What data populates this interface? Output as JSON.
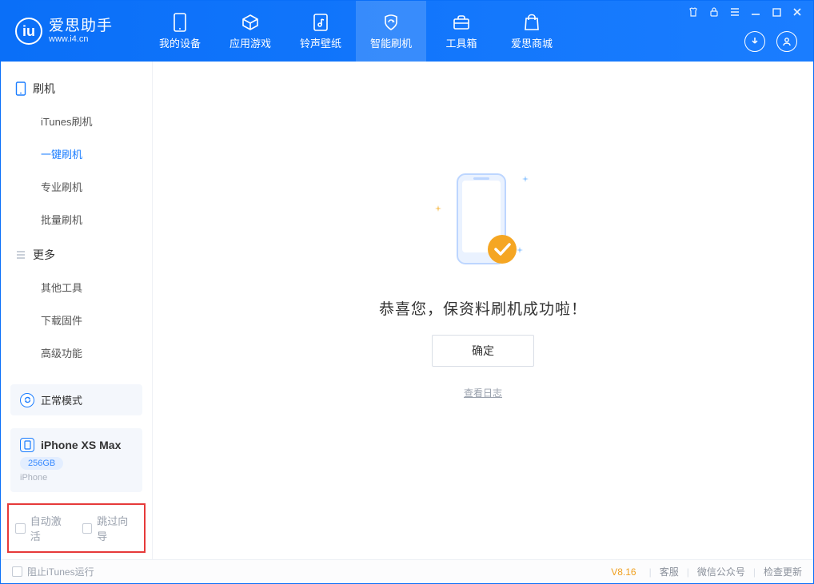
{
  "brand": {
    "title": "爱思助手",
    "subtitle": "www.i4.cn"
  },
  "nav": {
    "items": [
      {
        "label": "我的设备"
      },
      {
        "label": "应用游戏"
      },
      {
        "label": "铃声壁纸"
      },
      {
        "label": "智能刷机"
      },
      {
        "label": "工具箱"
      },
      {
        "label": "爱思商城"
      }
    ],
    "active_index": 3
  },
  "sidebar": {
    "group1_title": "刷机",
    "group1_items": [
      "iTunes刷机",
      "一键刷机",
      "专业刷机",
      "批量刷机"
    ],
    "group1_active_index": 1,
    "group2_title": "更多",
    "group2_items": [
      "其他工具",
      "下载固件",
      "高级功能"
    ],
    "mode_label": "正常模式",
    "device_name": "iPhone XS Max",
    "device_capacity": "256GB",
    "device_type": "iPhone",
    "checkbox_auto_activate": "自动激活",
    "checkbox_skip_guide": "跳过向导"
  },
  "main": {
    "success_title": "恭喜您，保资料刷机成功啦！",
    "ok_button": "确定",
    "view_log": "查看日志"
  },
  "footer": {
    "stop_itunes": "阻止iTunes运行",
    "version": "V8.16",
    "link_support": "客服",
    "link_wechat": "微信公众号",
    "link_update": "检查更新"
  },
  "colors": {
    "primary": "#1a7dff",
    "accent": "#f5a623",
    "badge": "#f0a020"
  }
}
